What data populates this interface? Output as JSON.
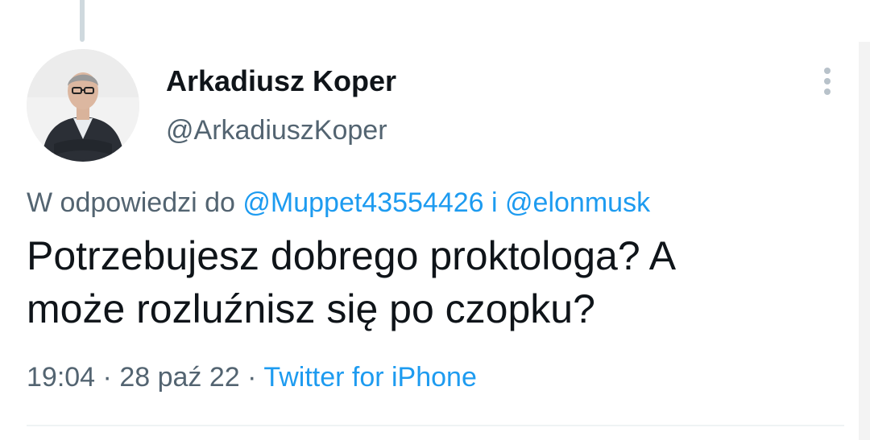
{
  "tweet": {
    "author_name": "Arkadiusz Koper",
    "author_handle": "@ArkadiuszKoper",
    "reply_prefix": "W odpowiedzi do",
    "reply_user_1": "@Muppet43554426",
    "reply_joiner": "i",
    "reply_user_2": "@elonmusk",
    "text_line_1": "Potrzebujesz dobrego proktologa? A",
    "text_line_2": "może rozluźnisz się po czopku?",
    "time": "19:04",
    "separator": "·",
    "date": "28 paź 22",
    "source": "Twitter for iPhone"
  },
  "icons": {
    "more": "more-vertical-icon",
    "avatar": "profile-photo"
  },
  "colors": {
    "text": "#0f1419",
    "secondary": "#536471",
    "link": "#1d9bf0",
    "thread_line": "#cfd9de",
    "divider": "#eff3f4"
  }
}
